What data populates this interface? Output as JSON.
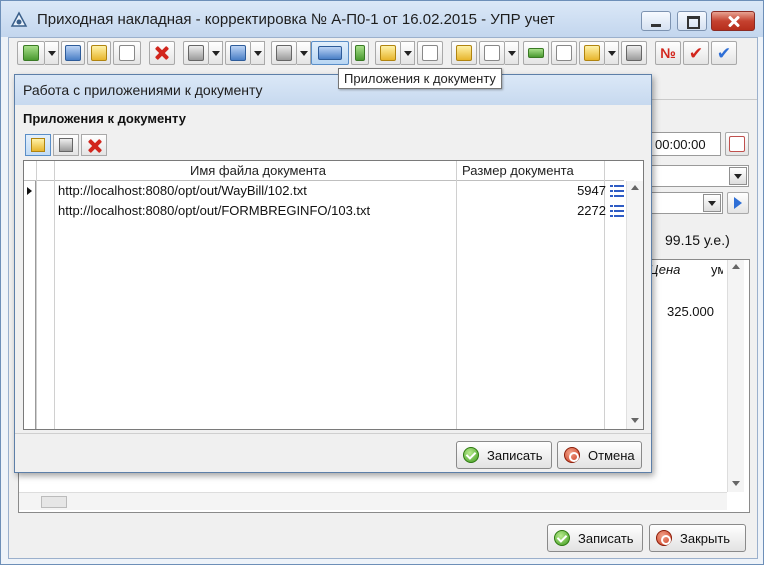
{
  "window": {
    "title": "Приходная накладная - корректировка № А-П0-1 от 16.02.2015 - УПР учет"
  },
  "toolbar": {
    "tooltip": "Приложения к документу",
    "number_button_label": "№"
  },
  "background_form": {
    "time_value": "00:00:00",
    "amount_text": "99.15 у.е.)",
    "column_price_header": "Цена",
    "column_partial_header": "ум",
    "price_value": "325.000"
  },
  "dialog": {
    "title": "Работа с приложениями к документу",
    "section_title": "Приложения к документу",
    "grid": {
      "columns": [
        "Имя файла документа",
        "Размер документа"
      ],
      "rows": [
        {
          "file": "http://localhost:8080/opt/out/WayBill/102.txt",
          "size": "5947",
          "icon": "list-icon"
        },
        {
          "file": "http://localhost:8080/opt/out/FORMBREGINFO/103.txt",
          "size": "2272",
          "icon": "list-icon"
        }
      ]
    },
    "buttons": {
      "save": "Записать",
      "cancel": "Отмена"
    }
  },
  "footer": {
    "save": "Записать",
    "close": "Закрыть"
  },
  "colors": {
    "title_bar": "#c7d9ef",
    "close_red": "#c5422f",
    "list_icon_blue": "#2f5cc4"
  }
}
